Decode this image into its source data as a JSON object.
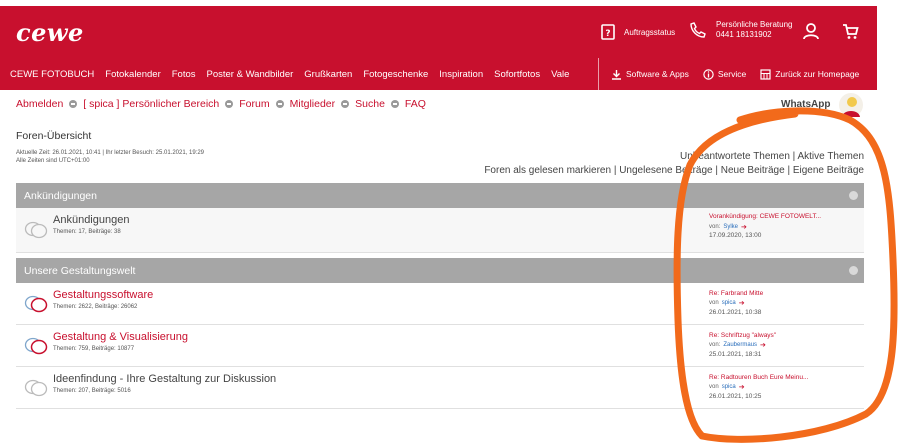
{
  "header": {
    "logo": "cewe",
    "order_status": "Auftragsstatus",
    "consult_title": "Persönliche Beratung",
    "consult_phone": "0441 18131902"
  },
  "nav": {
    "items": [
      "CEWE FOTOBUCH",
      "Fotokalender",
      "Fotos",
      "Poster & Wandbilder",
      "Grußkarten",
      "Fotogeschenke",
      "Inspiration",
      "Sofortfotos",
      "Vale"
    ],
    "software": "Software & Apps",
    "service": "Service",
    "home": "Zurück zur Homepage"
  },
  "breadcrumb": {
    "logout": "Abmelden",
    "personal": "[ spica ] Persönlicher Bereich",
    "forum": "Forum",
    "members": "Mitglieder",
    "search": "Suche",
    "faq": "FAQ"
  },
  "whatsapp": "WhatsApp",
  "page": {
    "title": "Foren-Übersicht",
    "time_line": "Aktuelle Zeit: 26.01.2021, 10:41 | Ihr letzter Besuch: 25.01.2021, 19:29",
    "tz_line": "Alle Zeiten sind UTC+01:00"
  },
  "quick_links": {
    "line1": "Unbeantwortete Themen | Aktive Themen",
    "line2": "Foren als gelesen markieren | Ungelesene Beiträge | Neue Beiträge | Eigene Beiträge"
  },
  "categories": [
    {
      "name": "Ankündigungen",
      "forums": [
        {
          "title": "Ankündigungen",
          "stats": "Themen: 17, Beiträge: 38",
          "last_title": "Vorankündigung: CEWE FOTOWELT...",
          "last_by": "von:",
          "last_author": "Sylke",
          "last_date": "17.09.2020, 13:00",
          "unread": false
        }
      ]
    },
    {
      "name": "Unsere Gestaltungswelt",
      "forums": [
        {
          "title": "Gestaltungssoftware",
          "stats": "Themen: 2622, Beiträge: 26062",
          "last_title": "Re: Farbrand Mitte",
          "last_by": "von",
          "last_author": "spica",
          "last_date": "26.01.2021, 10:38",
          "unread": true
        },
        {
          "title": "Gestaltung & Visualisierung",
          "stats": "Themen: 759, Beiträge: 10877",
          "last_title": "Re: Schriftzug \"always\"",
          "last_by": "von:",
          "last_author": "Zaubermaus",
          "last_date": "25.01.2021, 18:31",
          "unread": true
        },
        {
          "title": "Ideenfindung - Ihre Gestaltung zur Diskussion",
          "stats": "Themen: 207, Beiträge: 5016",
          "last_title": "Re: Radtouren Buch Eure Meinu...",
          "last_by": "von",
          "last_author": "spica",
          "last_date": "26.01.2021, 10:25",
          "unread": false
        }
      ]
    }
  ],
  "icons": {
    "order": "order-status-icon",
    "phone": "phone-icon",
    "user": "user-icon",
    "cart": "cart-icon",
    "download": "download-icon",
    "info": "info-icon",
    "home": "homepage-icon"
  },
  "colors": {
    "brand": "#c8102e",
    "category_bar": "#a6a6a6",
    "annotation": "#f26a1b"
  }
}
